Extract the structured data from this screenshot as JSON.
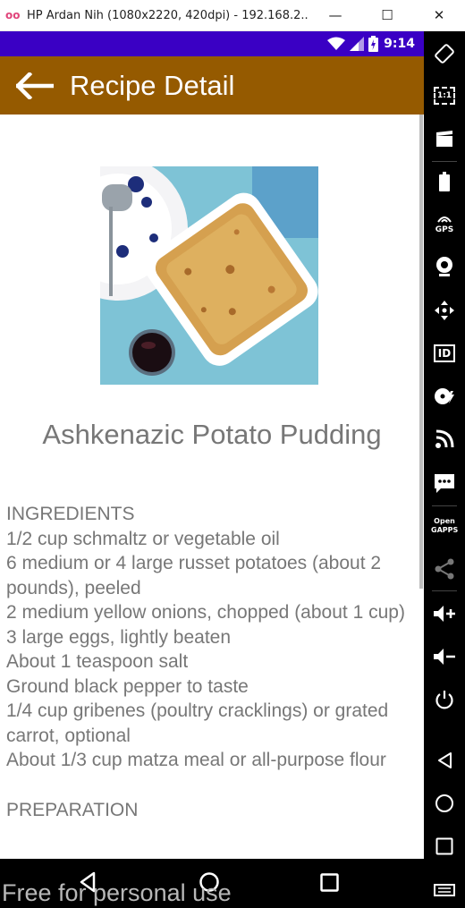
{
  "window": {
    "title": "HP Ardan Nih (1080x2220, 420dpi) - 192.168.2...",
    "minimize_label": "—",
    "maximize_label": "☐",
    "close_label": "✕"
  },
  "statusbar": {
    "time": "9:14"
  },
  "appbar": {
    "title": "Recipe Detail"
  },
  "recipe": {
    "title": "Ashkenazic Potato Pudding",
    "ingredients_heading": "INGREDIENTS",
    "ingredients": [
      "1/2 cup schmaltz or vegetable oil",
      "6 medium or 4 large russet potatoes (about 2 pounds), peeled",
      "2 medium yellow onions, chopped (about 1 cup)",
      "3 large eggs, lightly beaten",
      "About 1 teaspoon salt",
      "Ground black pepper to taste",
      "1/4 cup gribenes (poultry cracklings) or grated carrot, optional",
      "About 1/3 cup matza meal or all-purpose flour"
    ],
    "preparation_heading": "PREPARATION"
  },
  "watermark": "Free for personal use",
  "sidebar": {
    "gps_label": "GPS",
    "id_label": "ID",
    "opengapps_label": "Open GAPPS",
    "ratio_label": "1:1"
  },
  "colors": {
    "statusbar": "#3a00c4",
    "appbar": "#955a00",
    "text": "#777777"
  }
}
